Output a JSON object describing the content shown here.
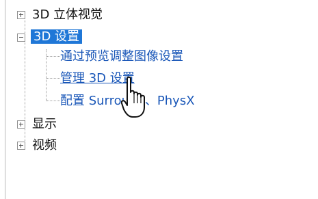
{
  "tree": {
    "items": [
      {
        "label": "3D 立体视觉",
        "expanded": false
      },
      {
        "label": "3D 设置",
        "expanded": true,
        "selected": true,
        "children": [
          {
            "label": "通过预览调整图像设置"
          },
          {
            "label": "管理 3D 设置",
            "hover": true
          },
          {
            "label": "配置 Surround、PhysX"
          }
        ]
      },
      {
        "label": "显示",
        "expanded": false
      },
      {
        "label": "视频",
        "expanded": false
      }
    ]
  },
  "colors": {
    "selection": "#1f77d7",
    "link": "#1a57b8"
  },
  "cursor": "hand-pointer-icon"
}
